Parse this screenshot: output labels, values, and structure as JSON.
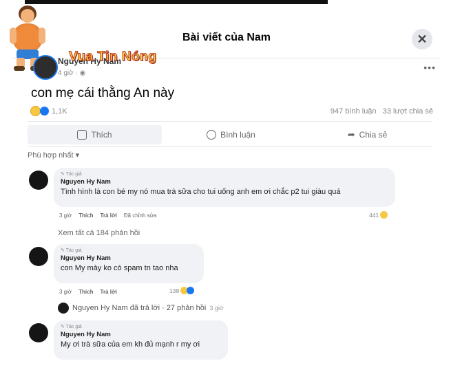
{
  "header": {
    "title": "Bài viết của Nam",
    "close_icon": "close-icon"
  },
  "brand": {
    "text": "Vua Tin Nóng",
    "color": "#f7d33a"
  },
  "post": {
    "author": "Nguyen Hy Nam",
    "meta": "4 giờ · ◉",
    "text": "con mẹ cái thằng An này",
    "reaction_count": "1,1K",
    "comments_count": "947 bình luận",
    "shares_count": "33 lượt chia sẻ"
  },
  "actions": {
    "like": "Thích",
    "comment": "Bình luận",
    "share": "Chia sẻ"
  },
  "sort": {
    "label": "Phù hợp nhất ▾"
  },
  "comments": [
    {
      "badge": "✎ Tác giả",
      "author": "Nguyen Hy Nam",
      "text": "Tình hình là con bé my nó mua trà sữa cho tui uống anh em ơi chắc p2 tui giàu quá",
      "time": "3 giờ",
      "like": "Thích",
      "reply": "Trả lời",
      "edited": "Đã chỉnh sửa",
      "reactions": "441"
    },
    {
      "badge": "✎ Tác giả",
      "author": "Nguyen Hy Nam",
      "text": "con My mày ko có spam tn tao nha",
      "time": "3 giờ",
      "like": "Thích",
      "reply": "Trả lời",
      "reactions": "138"
    },
    {
      "badge": "✎ Tác giả",
      "author": "Nguyen Hy Nam",
      "text": "My ơi trà sữa của em kh đủ mạnh r my ơi"
    }
  ],
  "view_all": "Xem tất cả 184 phản hồi",
  "reply_summary": {
    "text": "Nguyen Hy Nam đã trả lời · 27 phản hồi",
    "time": "3 giờ"
  }
}
